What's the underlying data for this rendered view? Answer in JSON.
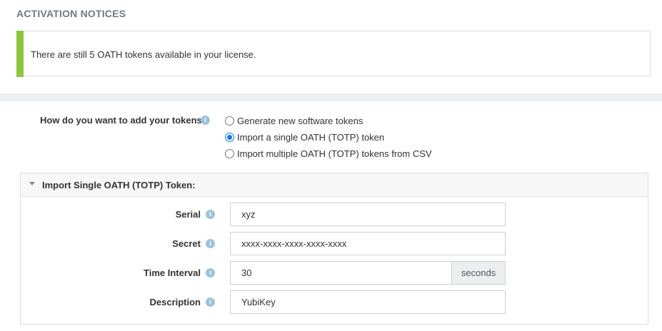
{
  "section": {
    "title": "ACTIVATION NOTICES"
  },
  "notice": {
    "text": "There are still 5 OATH tokens available in your license."
  },
  "question": {
    "label": "How do you want to add your tokens?",
    "options": [
      {
        "label": "Generate new software tokens",
        "selected": false
      },
      {
        "label": "Import a single OATH (TOTP) token",
        "selected": true
      },
      {
        "label": "Import multiple OATH (TOTP) tokens from CSV",
        "selected": false
      }
    ]
  },
  "panel": {
    "title": "Import Single OATH (TOTP) Token:",
    "fields": {
      "serial": {
        "label": "Serial",
        "value": "xyz"
      },
      "secret": {
        "label": "Secret",
        "value": "xxxx-xxxx-xxxx-xxxx-xxxx"
      },
      "interval": {
        "label": "Time Interval",
        "value": "30",
        "unit": "seconds"
      },
      "description": {
        "label": "Description",
        "value": "YubiKey"
      }
    }
  },
  "colors": {
    "accent": "#8dc63f",
    "radio": "#1a73e8",
    "info": "#9cc3df"
  },
  "icons": {
    "info": "info-icon",
    "caret": "caret-down-icon"
  }
}
